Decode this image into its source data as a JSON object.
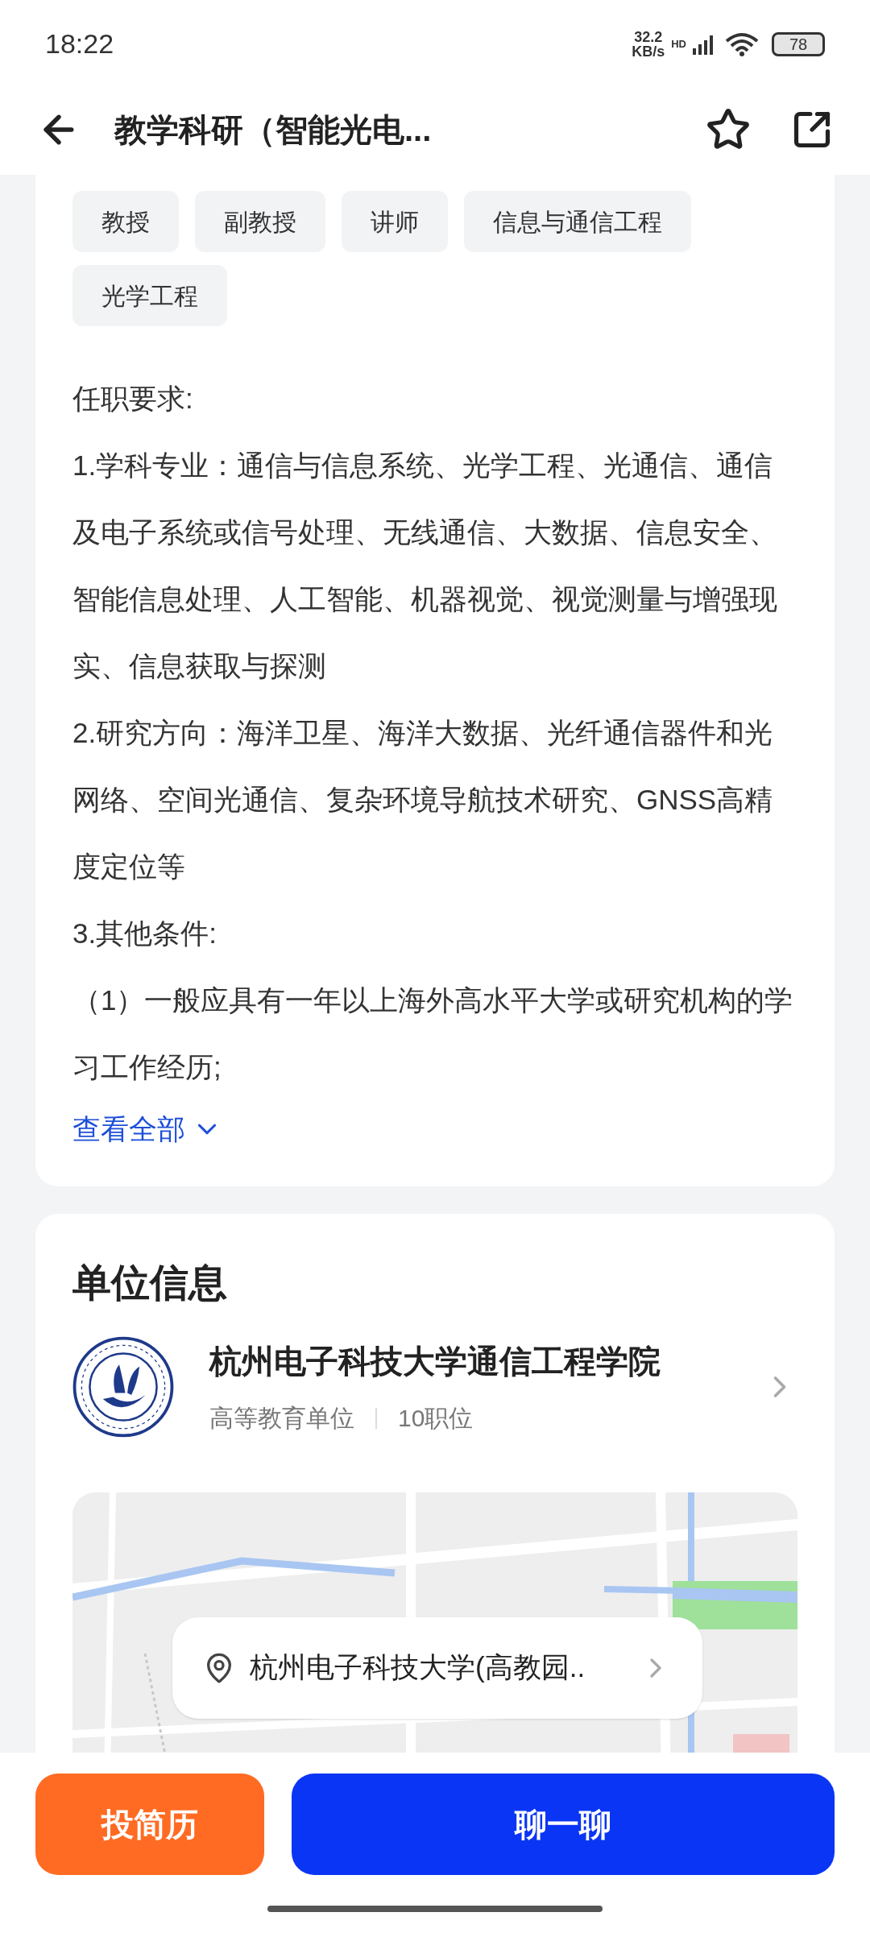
{
  "status_bar": {
    "time": "18:22",
    "net_speed": "32.2",
    "net_unit": "KB/s",
    "hd": "HD",
    "battery": "78"
  },
  "header": {
    "title": "教学科研（智能光电..."
  },
  "tags": [
    "教授",
    "副教授",
    "讲师",
    "信息与通信工程",
    "光学工程"
  ],
  "requirements": {
    "heading": "任职要求:",
    "paragraphs": [
      "1.学科专业：通信与信息系统、光学工程、光通信、通信及电子系统或信号处理、无线通信、大数据、信息安全、智能信息处理、人工智能、机器视觉、视觉测量与增强现实、信息获取与探测",
      "2.研究方向：海洋卫星、海洋大数据、光纤通信器件和光网络、空间光通信、复杂环境导航技术研究、GNSS高精度定位等",
      "3.其他条件:",
      "（1）一般应具有一年以上海外高水平大学或研究机构的学习工作经历;"
    ],
    "see_all": "查看全部"
  },
  "unit_info": {
    "title": "单位信息",
    "name": "杭州电子科技大学通信工程学院",
    "type": "高等教育单位",
    "positions": "10职位",
    "location": "杭州电子科技大学(高教园.."
  },
  "buttons": {
    "resume": "投简历",
    "chat": "聊一聊"
  }
}
